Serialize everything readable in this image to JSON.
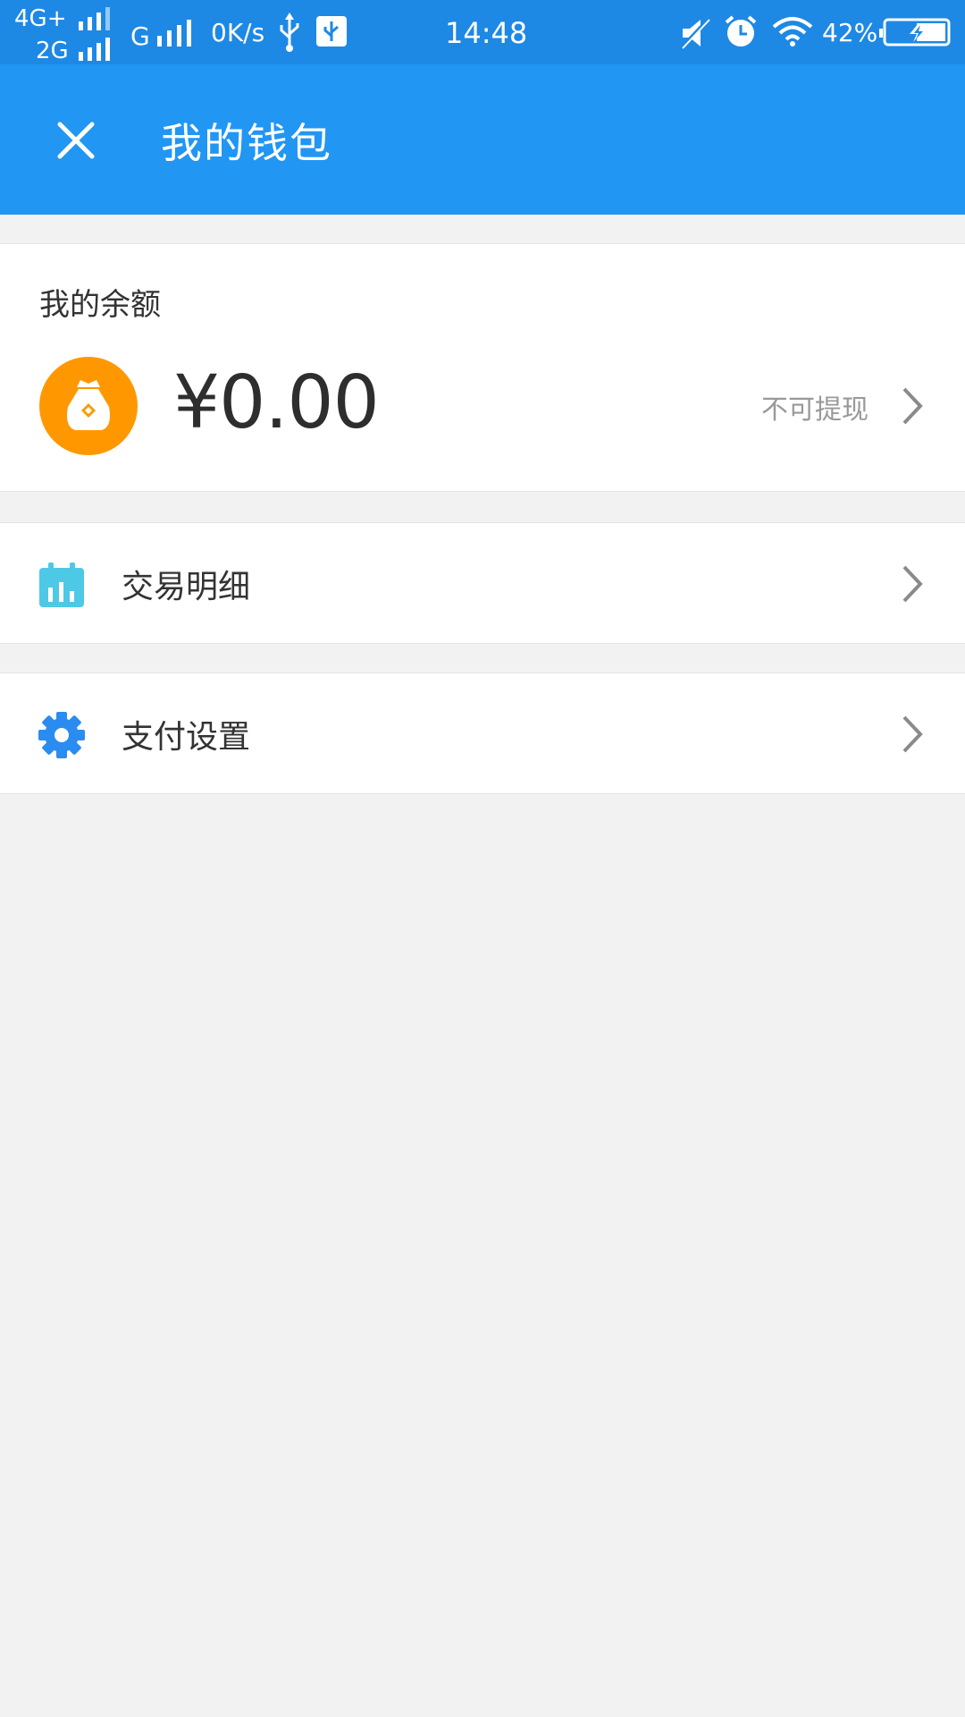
{
  "status_bar": {
    "network_1": "4G+",
    "network_2": "2G",
    "network_3": "G",
    "speed": "0K/s",
    "time": "14:48",
    "battery": "42%",
    "icons": [
      "signal-icon",
      "usb-icon",
      "usb-debug-icon",
      "mute-icon",
      "alarm-icon",
      "wifi-icon",
      "battery-charging-icon"
    ]
  },
  "header": {
    "title": "我的钱包",
    "close_icon": "close-icon"
  },
  "balance": {
    "label": "我的余额",
    "amount": "¥0.00",
    "withdraw_status": "不可提现",
    "icon": "money-bag-icon",
    "icon_color": "#ff9800"
  },
  "menu": {
    "items": [
      {
        "label": "交易明细",
        "icon": "calendar-chart-icon",
        "icon_color": "#4dc9e6"
      },
      {
        "label": "支付设置",
        "icon": "gear-icon",
        "icon_color": "#2a8cf0"
      }
    ]
  },
  "colors": {
    "status_bar": "#1e88e5",
    "app_bar": "#2196f3",
    "background": "#f2f2f2"
  }
}
